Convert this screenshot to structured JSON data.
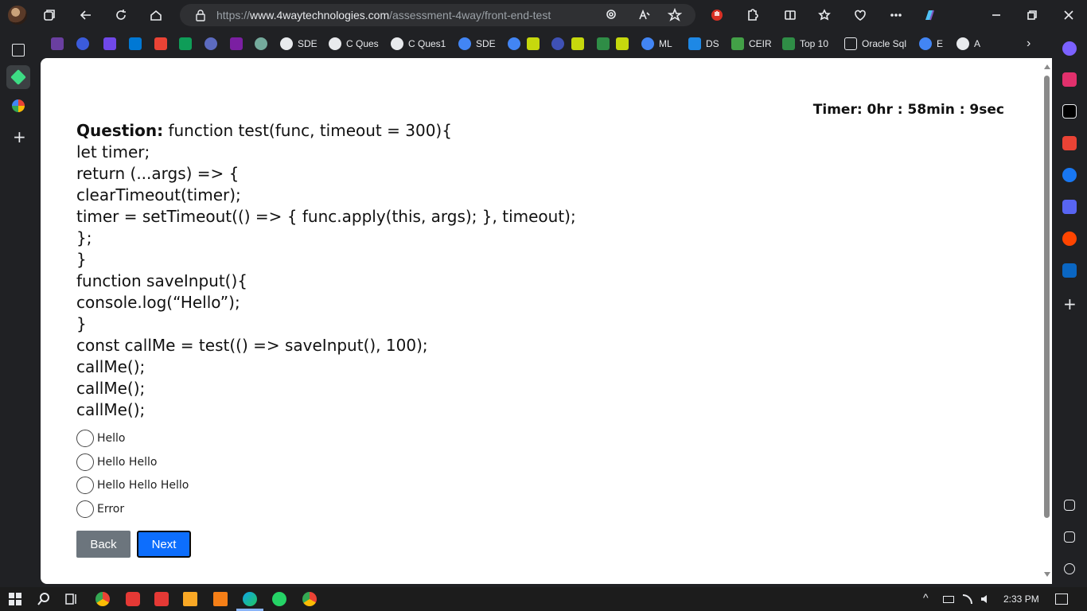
{
  "browser": {
    "url_prefix": "https://",
    "url_host": "www.4waytechnologies.com",
    "url_path": "/assessment-4way/front-end-test",
    "bookmarks": [
      "SDE",
      "C Ques",
      "C Ques1",
      "SDE",
      "ML",
      "DS",
      "CEIR",
      "Top 10",
      "Oracle Sql",
      "E",
      "A"
    ]
  },
  "page": {
    "timer": "Timer: 0hr : 58min : 9sec",
    "question_label": "Question:",
    "question_lines": [
      " function test(func, timeout = 300){",
      "let timer;",
      "return (...args) => {",
      "clearTimeout(timer);",
      "timer = setTimeout(() => { func.apply(this, args); }, timeout);",
      "};",
      "}",
      "function saveInput(){",
      "console.log(“Hello”);",
      "}",
      "const callMe = test(() => saveInput(), 100);",
      "callMe();",
      "callMe();",
      "callMe();"
    ],
    "options": [
      "Hello",
      "Hello Hello",
      "Hello Hello Hello",
      "Error"
    ],
    "back_label": "Back",
    "next_label": "Next"
  },
  "taskbar": {
    "time": "2:33 PM"
  },
  "colors": {
    "next_button": "#0d6efd",
    "back_button": "#6c757d",
    "chrome_bg": "#202124"
  }
}
